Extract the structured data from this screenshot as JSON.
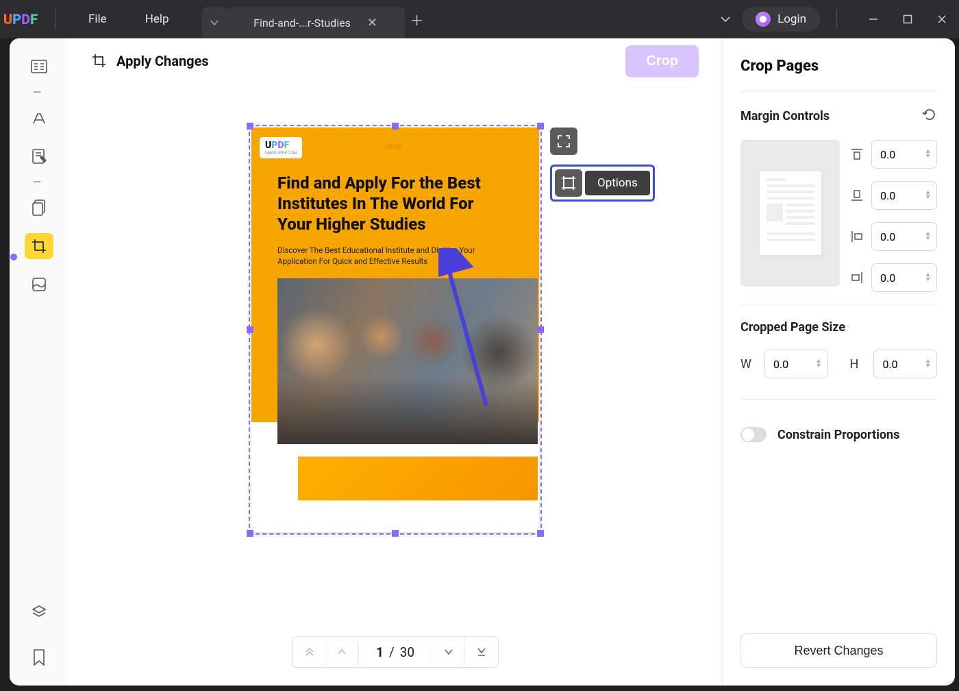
{
  "titlebar": {
    "logo": "UPDF",
    "menu": {
      "file": "File",
      "help": "Help"
    },
    "tab": {
      "name": "Find-and-...r-Studies"
    },
    "login": "Login"
  },
  "topbar": {
    "apply": "Apply Changes",
    "crop": "Crop"
  },
  "page_content": {
    "brand": "UPDF",
    "title": "Find and Apply For the Best Institutes In The World For Your Higher Studies",
    "subtitle": "Discover The Best Educational Institute and Digitize Your Application For Quick and Effective Results"
  },
  "float_tools": {
    "options_tip": "Options"
  },
  "pager": {
    "current": "1",
    "sep": "/",
    "total": "30"
  },
  "panel": {
    "title": "Crop Pages",
    "margin_label": "Margin Controls",
    "margins": {
      "top": "0.0",
      "bottom": "0.0",
      "left": "0.0",
      "right": "0.0"
    },
    "size_label": "Cropped Page Size",
    "size": {
      "w_label": "W",
      "w": "0.0",
      "h_label": "H",
      "h": "0.0"
    },
    "constrain_label": "Constrain Proportions",
    "revert": "Revert Changes"
  }
}
